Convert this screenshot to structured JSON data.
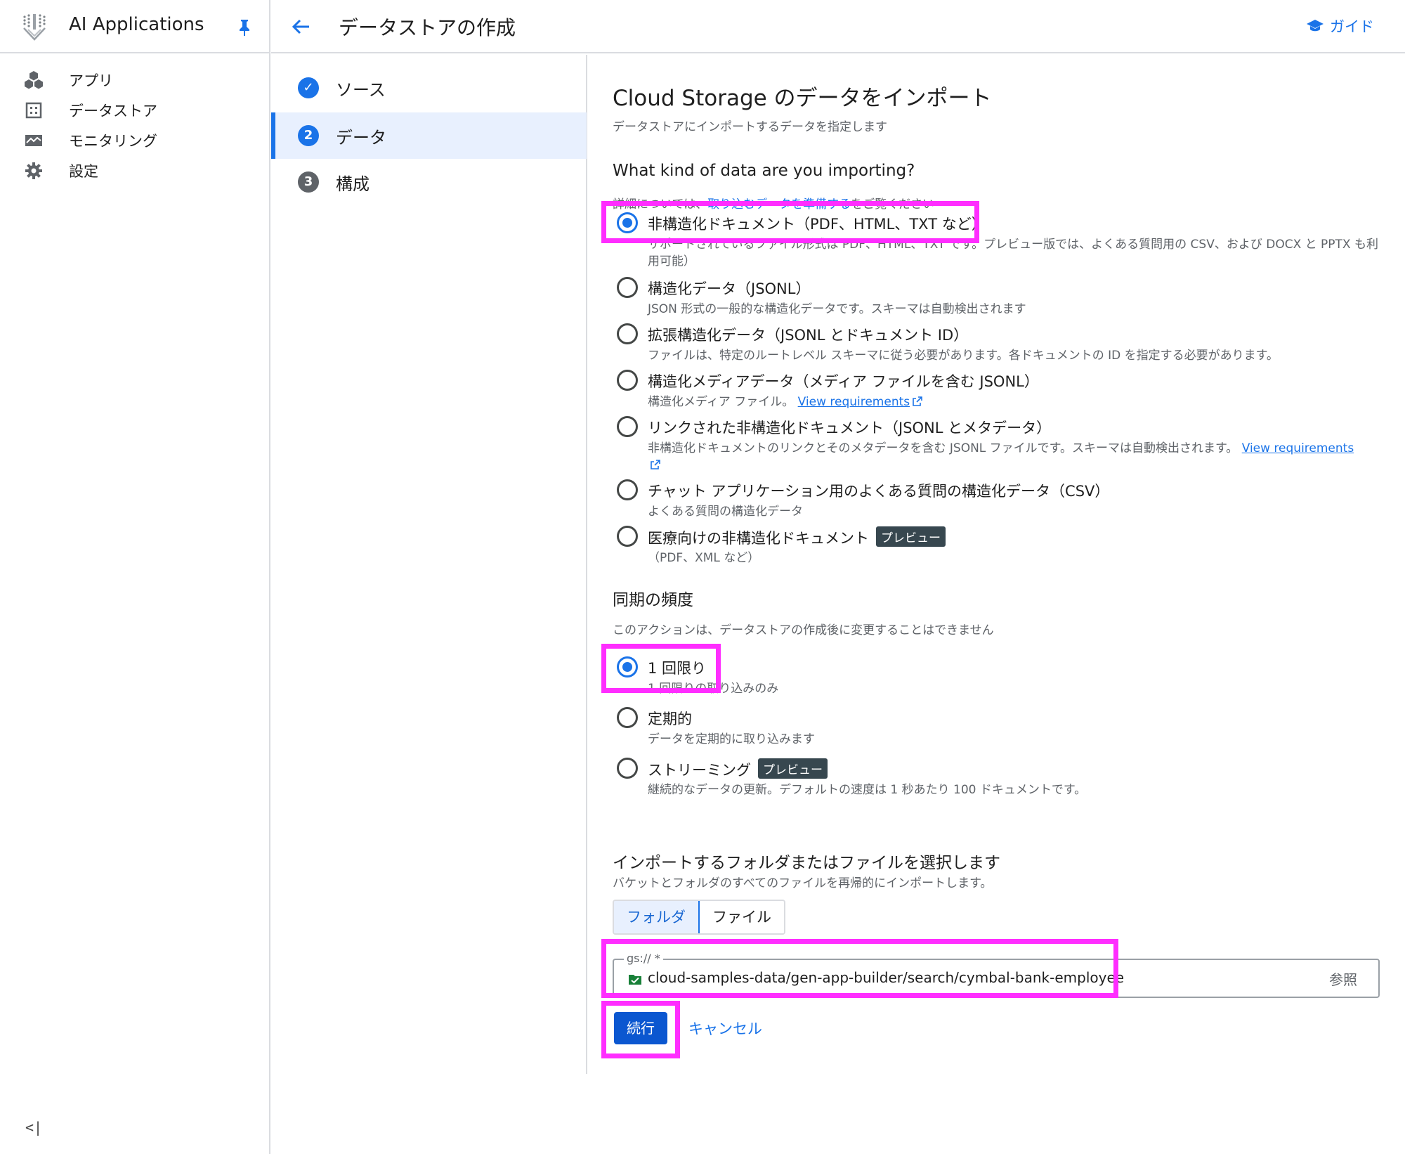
{
  "nav": {
    "app_title": "AI Applications",
    "items": [
      {
        "label": "アプリ",
        "icon": "apps-icon"
      },
      {
        "label": "データストア",
        "icon": "datastore-icon"
      },
      {
        "label": "モニタリング",
        "icon": "monitoring-icon"
      },
      {
        "label": "設定",
        "icon": "gear-icon"
      }
    ],
    "collapse_glyph": "<|"
  },
  "header": {
    "title": "データストアの作成",
    "guide_label": "ガイド"
  },
  "stepper": {
    "steps": [
      {
        "number": "✓",
        "label": "ソース",
        "state": "done"
      },
      {
        "number": "2",
        "label": "データ",
        "state": "active"
      },
      {
        "number": "3",
        "label": "構成",
        "state": "pending"
      }
    ]
  },
  "main": {
    "title": "Cloud Storage のデータをインポート",
    "subtitle": "データストアにインポートするデータを指定します",
    "data_kind": {
      "heading": "What kind of data are you importing?",
      "hint_prefix": "詳細については、",
      "hint_link": "取り込むデータを準備する",
      "hint_suffix": "をご覧ください",
      "options": [
        {
          "label": "非構造化ドキュメント（PDF、HTML、TXT など）",
          "desc": "サポートされているファイル形式は PDF、HTML、TXT です。プレビュー版では、よくある質問用の CSV、および DOCX と PPTX も利用可能）",
          "checked": true
        },
        {
          "label": "構造化データ（JSONL）",
          "desc": "JSON 形式の一般的な構造化データです。スキーマは自動検出されます",
          "checked": false
        },
        {
          "label": "拡張構造化データ（JSONL とドキュメント ID）",
          "desc": "ファイルは、特定のルートレベル スキーマに従う必要があります。各ドキュメントの ID を指定する必要があります。",
          "checked": false
        },
        {
          "label": "構造化メディアデータ（メディア ファイルを含む JSONL）",
          "desc": "構造化メディア ファイル。",
          "link": "View requirements",
          "checked": false
        },
        {
          "label": "リンクされた非構造化ドキュメント（JSONL とメタデータ）",
          "desc": "非構造化ドキュメントのリンクとそのメタデータを含む JSONL ファイルです。スキーマは自動検出されます。",
          "link": "View requirements",
          "checked": false
        },
        {
          "label": "チャット アプリケーション用のよくある質問の構造化データ（CSV）",
          "desc": "よくある質問の構造化データ",
          "checked": false
        },
        {
          "label": "医療向けの非構造化ドキュメント",
          "badge": "プレビュー",
          "desc": "（PDF、XML など）",
          "checked": false
        }
      ]
    },
    "sync": {
      "heading": "同期の頻度",
      "hint": "このアクションは、データストアの作成後に変更することはできません",
      "options": [
        {
          "label": "1 回限り",
          "desc": "1 回限りの取り込みのみ",
          "checked": true
        },
        {
          "label": "定期的",
          "desc": "データを定期的に取り込みます",
          "checked": false
        },
        {
          "label": "ストリーミング",
          "badge": "プレビュー",
          "desc": "継続的なデータの更新。デフォルトの速度は 1 秒あたり 100 ドキュメントです。",
          "checked": false
        }
      ]
    },
    "import": {
      "heading": "インポートするフォルダまたはファイルを選択します",
      "hint": "バケットとフォルダのすべてのファイルを再帰的にインポートします。",
      "toggle": [
        "フォルダ",
        "ファイル"
      ],
      "gs_label": "gs:// *",
      "gs_value": "cloud-samples-data/gen-app-builder/search/cymbal-bank-employee",
      "browse_label": "参照"
    },
    "continue_label": "続行",
    "cancel_label": "キャンセル"
  },
  "colors": {
    "accent": "#1a73e8",
    "highlight": "#ff2dff",
    "badge": "#37474f"
  }
}
